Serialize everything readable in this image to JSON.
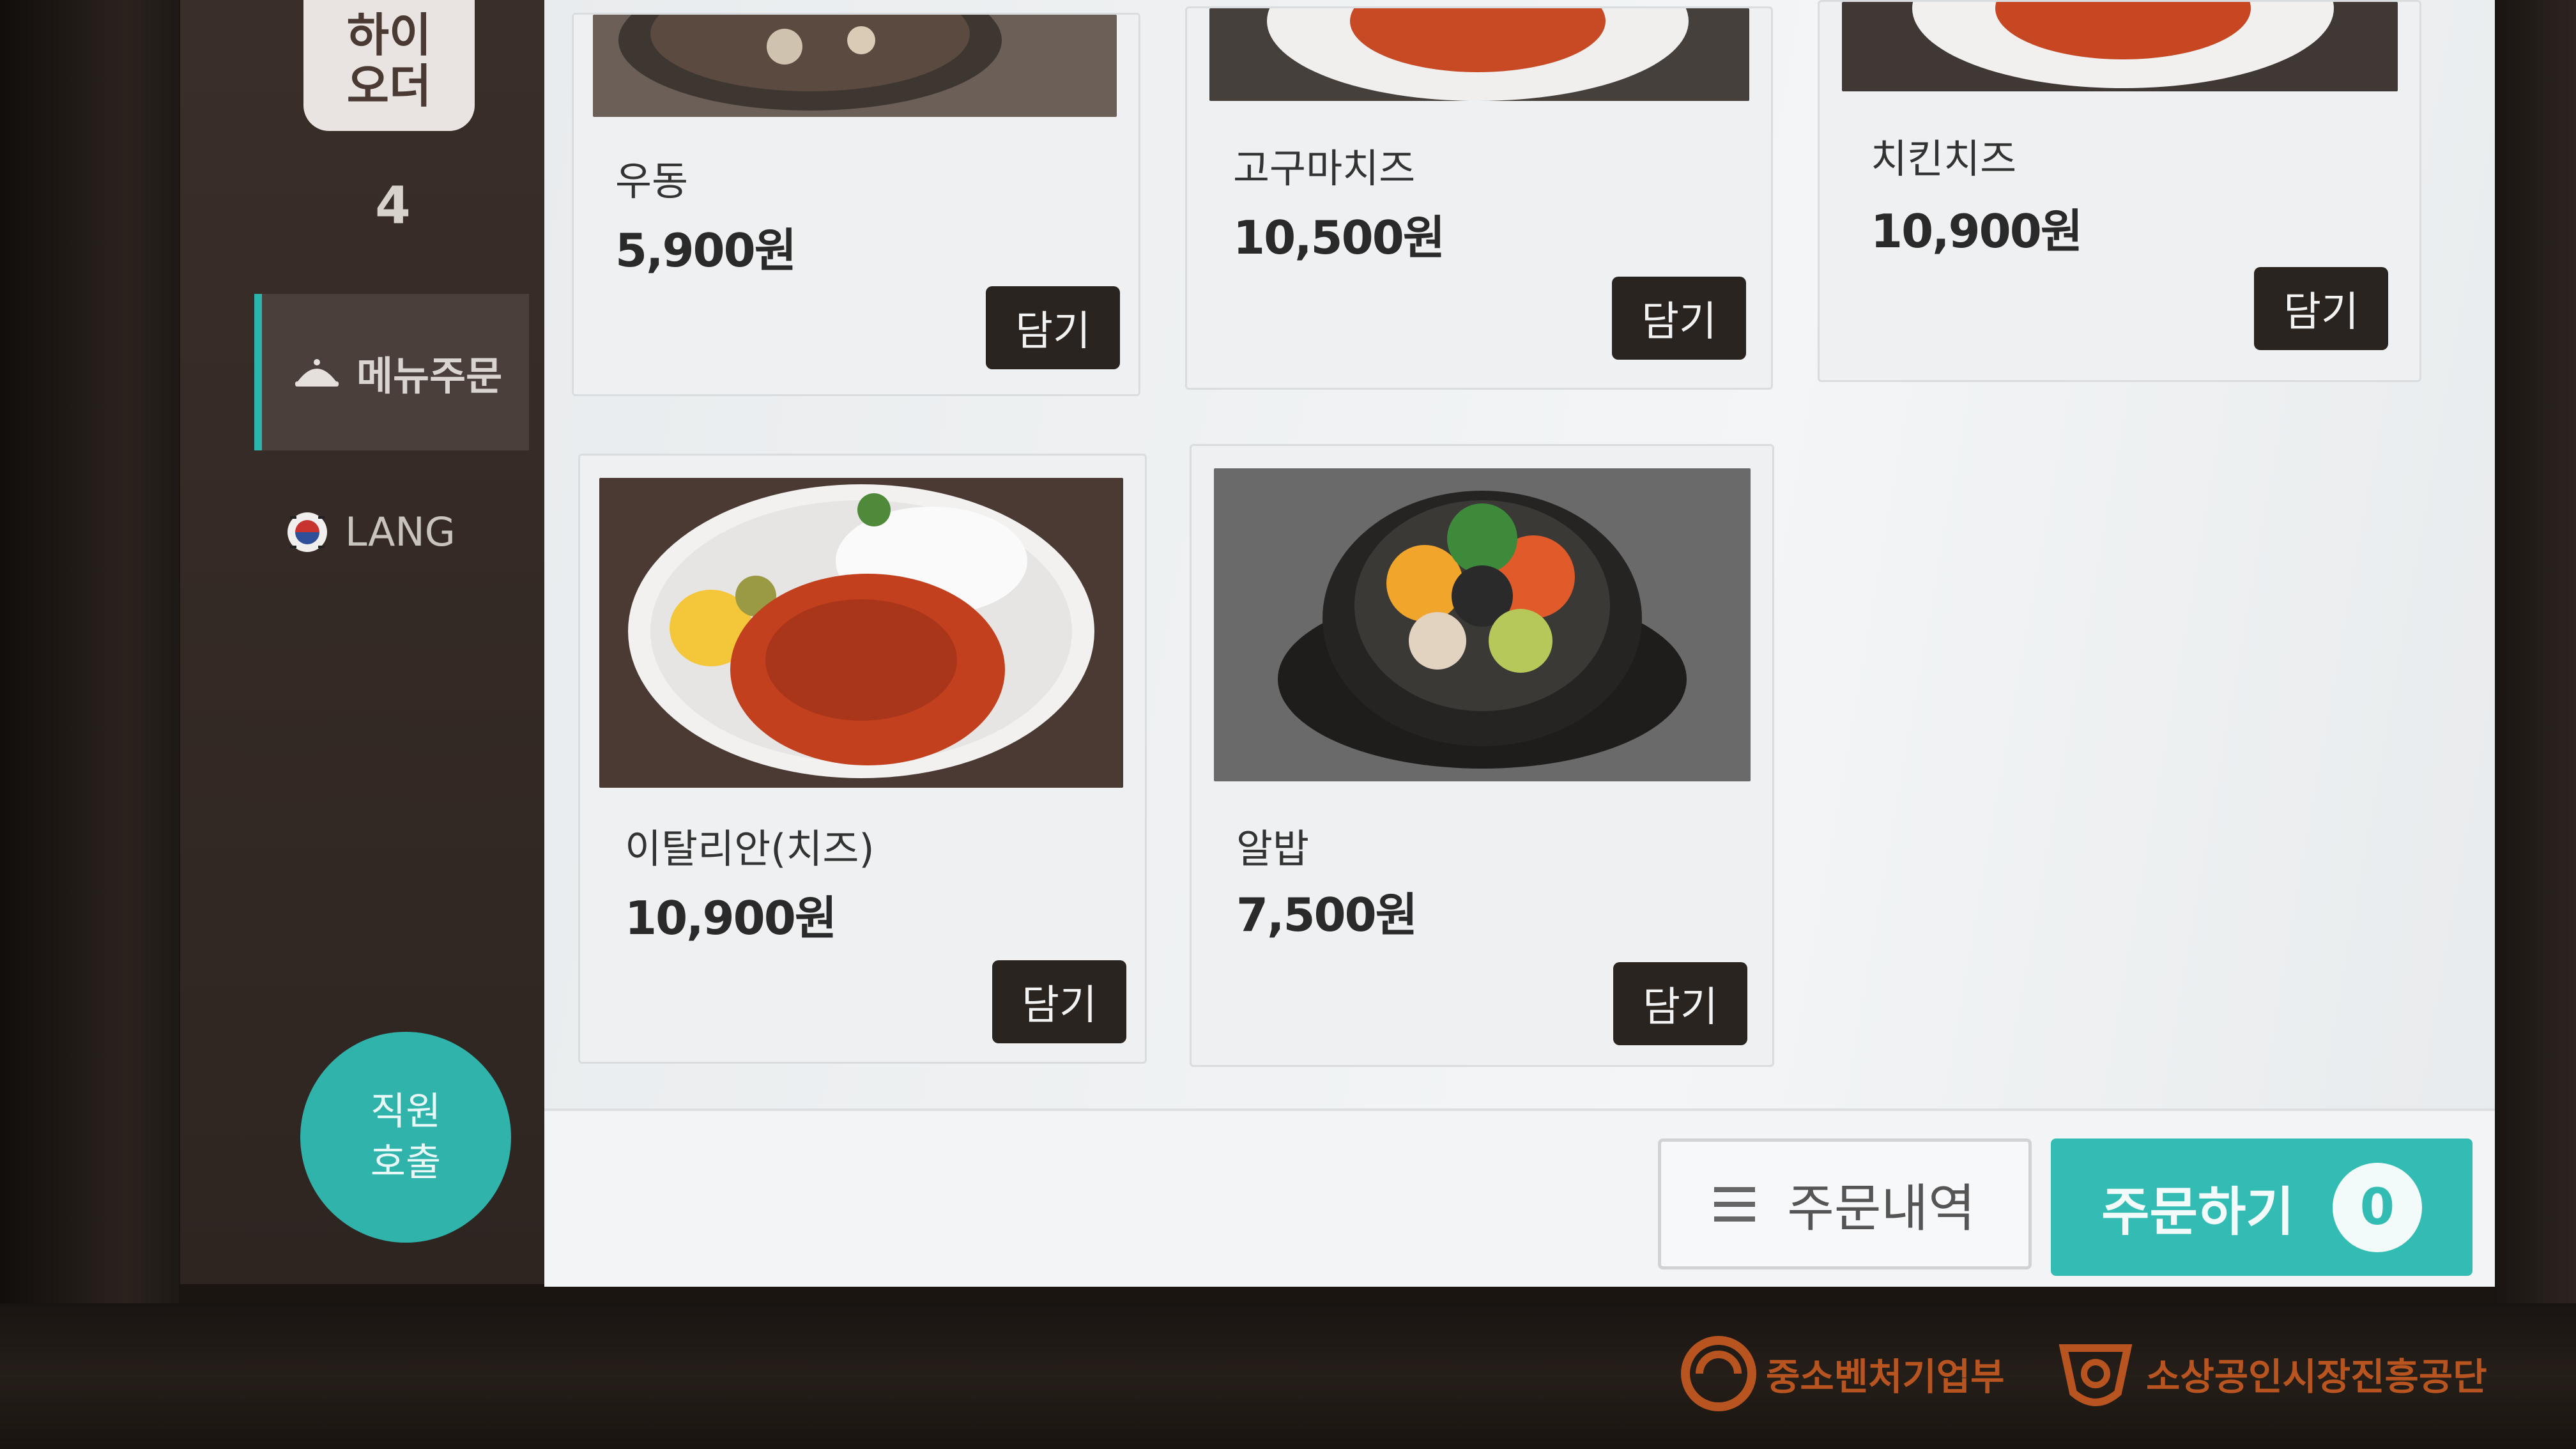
{
  "brand": {
    "line1": "하이",
    "line2": "오더"
  },
  "table_number": "4",
  "sidebar": {
    "menu_order": "메뉴주문",
    "lang": "LANG",
    "staff_call_line1": "직원",
    "staff_call_line2": "호출"
  },
  "menu_items": [
    {
      "name": "우동",
      "price": "5,900원",
      "button": "담기"
    },
    {
      "name": "고구마치즈",
      "price": "10,500원",
      "button": "담기"
    },
    {
      "name": "치킨치즈",
      "price": "10,900원",
      "button": "담기"
    },
    {
      "name": "이탈리안(치즈)",
      "price": "10,900원",
      "button": "담기"
    },
    {
      "name": "알밥",
      "price": "7,500원",
      "button": "담기"
    }
  ],
  "bottom": {
    "history_label": "주문내역",
    "order_label": "주문하기",
    "cart_count": "0"
  },
  "footer": {
    "logo1": "중소벤처기업부",
    "logo2": "소상공인시장진흥공단"
  },
  "colors": {
    "accent": "#2bb5ad",
    "button_dark": "#2a2420",
    "sidebar_bg": "#3a2e28"
  }
}
